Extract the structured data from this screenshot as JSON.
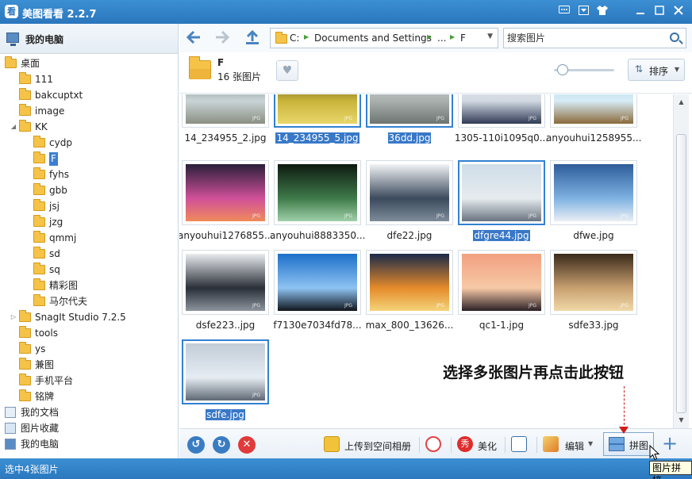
{
  "window": {
    "title": "美图看看 2.2.7",
    "app_icon_char": "看"
  },
  "sidebar": {
    "header": "我的电脑",
    "tree": [
      {
        "label": "桌面",
        "level": 0,
        "type": "folder",
        "arrow": ""
      },
      {
        "label": "111",
        "level": 1,
        "type": "folder",
        "arrow": ""
      },
      {
        "label": "bakcuptxt",
        "level": 1,
        "type": "folder",
        "arrow": ""
      },
      {
        "label": "image",
        "level": 1,
        "type": "folder",
        "arrow": ""
      },
      {
        "label": "KK",
        "level": 1,
        "type": "folder",
        "arrow": "expanded"
      },
      {
        "label": "cydp",
        "level": 2,
        "type": "folder",
        "arrow": ""
      },
      {
        "label": "F",
        "level": 2,
        "type": "folder",
        "arrow": "",
        "selected": true
      },
      {
        "label": "fyhs",
        "level": 2,
        "type": "folder",
        "arrow": ""
      },
      {
        "label": "gbb",
        "level": 2,
        "type": "folder",
        "arrow": ""
      },
      {
        "label": "jsj",
        "level": 2,
        "type": "folder",
        "arrow": ""
      },
      {
        "label": "jzg",
        "level": 2,
        "type": "folder",
        "arrow": ""
      },
      {
        "label": "qmmj",
        "level": 2,
        "type": "folder",
        "arrow": ""
      },
      {
        "label": "sd",
        "level": 2,
        "type": "folder",
        "arrow": ""
      },
      {
        "label": "sq",
        "level": 2,
        "type": "folder",
        "arrow": ""
      },
      {
        "label": "精彩图",
        "level": 2,
        "type": "folder",
        "arrow": ""
      },
      {
        "label": "马尔代夫",
        "level": 2,
        "type": "folder",
        "arrow": ""
      },
      {
        "label": "SnagIt Studio 7.2.5",
        "level": 1,
        "type": "folder",
        "arrow": "collapsed"
      },
      {
        "label": "tools",
        "level": 1,
        "type": "folder",
        "arrow": ""
      },
      {
        "label": "ys",
        "level": 1,
        "type": "folder",
        "arrow": ""
      },
      {
        "label": "兼图",
        "level": 1,
        "type": "folder",
        "arrow": ""
      },
      {
        "label": "手机平台",
        "level": 1,
        "type": "folder",
        "arrow": ""
      },
      {
        "label": "铭牌",
        "level": 1,
        "type": "folder",
        "arrow": ""
      },
      {
        "label": "我的文档",
        "level": 0,
        "type": "docs",
        "arrow": ""
      },
      {
        "label": "图片收藏",
        "level": 0,
        "type": "pics",
        "arrow": ""
      },
      {
        "label": "我的电脑",
        "level": 0,
        "type": "pc",
        "arrow": ""
      }
    ]
  },
  "toolbar": {
    "back_icon": "arrow-left-icon",
    "forward_icon": "arrow-right-icon",
    "up_icon": "upload-arrow-icon",
    "breadcrumb": [
      "C:",
      "Documents and Settings",
      "...",
      "F"
    ],
    "search_placeholder": "搜索图片"
  },
  "folder_info": {
    "name": "F",
    "count": "16 张图片",
    "sort_label": "排序",
    "zoom_level": 0.15
  },
  "images": [
    {
      "name": "14_234955_2.jpg",
      "selected": false,
      "colors": [
        "#5e6b72",
        "#c9d4d6",
        "#8a8f82"
      ]
    },
    {
      "name": "14_234955_5.jpg",
      "selected": true,
      "colors": [
        "#2e2a1a",
        "#c9b43a",
        "#e8d66a"
      ]
    },
    {
      "name": "36dd.jpg",
      "selected": true,
      "colors": [
        "#dfe3e2",
        "#a9b0ae",
        "#6d7472"
      ]
    },
    {
      "name": "1305-110i1095q0...",
      "selected": false,
      "colors": [
        "#eef1f4",
        "#d2d9e2",
        "#2f3a55"
      ]
    },
    {
      "name": "anyouhui1258955...",
      "selected": false,
      "colors": [
        "#9fd2ec",
        "#d7ecf6",
        "#8a6a3a"
      ]
    },
    {
      "name": "anyouhui1276855...",
      "selected": false,
      "colors": [
        "#2a1f3a",
        "#d0509a",
        "#f08a5a"
      ]
    },
    {
      "name": "anyouhui8883350...",
      "selected": false,
      "colors": [
        "#0d1a10",
        "#3f7a4a",
        "#9fd0a8"
      ]
    },
    {
      "name": "dfe22.jpg",
      "selected": false,
      "colors": [
        "#f1f3f5",
        "#3b4a5c",
        "#7e8c9a"
      ]
    },
    {
      "name": "dfgre44.jpg",
      "selected": true,
      "colors": [
        "#cfdde9",
        "#e6ebee",
        "#6a7480"
      ]
    },
    {
      "name": "dfwe.jpg",
      "selected": false,
      "colors": [
        "#2d5c9a",
        "#7fb2e2",
        "#e9eef4"
      ]
    },
    {
      "name": "dsfe223..jpg",
      "selected": false,
      "colors": [
        "#e9ecef",
        "#2a2f38",
        "#8c949d"
      ]
    },
    {
      "name": "f7130e7034fd78...",
      "selected": false,
      "colors": [
        "#1c6fc9",
        "#8ec3f2",
        "#10141c"
      ]
    },
    {
      "name": "max_800_13626...",
      "selected": false,
      "colors": [
        "#1b2a4a",
        "#e58b2a",
        "#f4d37a"
      ]
    },
    {
      "name": "qc1-1.jpg",
      "selected": false,
      "colors": [
        "#f2a080",
        "#f6c9a6",
        "#2a2026"
      ]
    },
    {
      "name": "sdfe33.jpg",
      "selected": false,
      "colors": [
        "#3a2a1a",
        "#c8a070",
        "#f0d8a8"
      ]
    },
    {
      "name": "sdfe.jpg",
      "selected": true,
      "colors": [
        "#c2cdd8",
        "#e6ecf2",
        "#5e6874"
      ]
    }
  ],
  "bottombar": {
    "upload_label": "上传到空间相册",
    "beautify_label": "美化",
    "edit_label": "编辑",
    "collage_label": "拼图"
  },
  "status": {
    "text": "选中4张图片"
  },
  "annotation": {
    "text": "选择多张图片再点击此按钮"
  },
  "tooltip": {
    "text": "图片拼接"
  },
  "accent_color": "#3281d2"
}
